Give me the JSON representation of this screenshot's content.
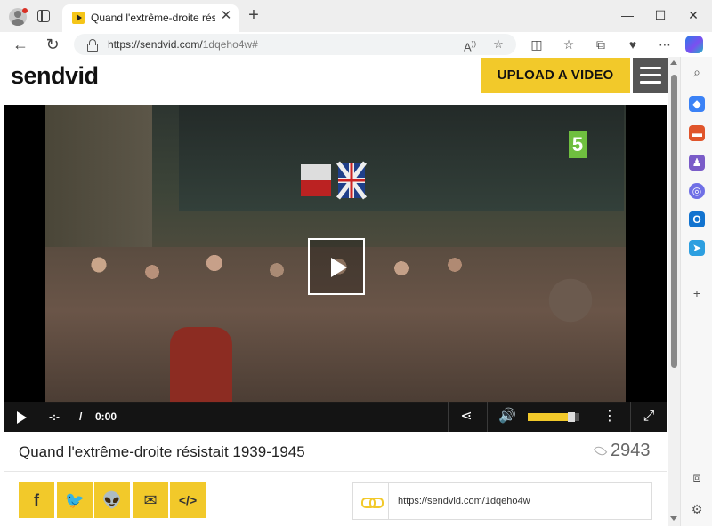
{
  "browser": {
    "tab_title": "Quand l'extrême-droite résistait",
    "url_host": "https://sendvid.com/",
    "url_path": "1dqeho4w#",
    "window_controls": {
      "minimize": "—",
      "maximize": "☐",
      "close": "✕"
    }
  },
  "page": {
    "logo": "sendvid",
    "upload_label": "UPLOAD A VIDEO"
  },
  "player": {
    "current_time": "-:-",
    "separator": "/",
    "duration": "0:00",
    "volume_fraction": 0.85,
    "channel_badge": "5"
  },
  "video": {
    "title": "Quand l'extrême-droite résistait 1939-1945",
    "views": "2943"
  },
  "share": {
    "buttons": [
      "f",
      "🐦",
      "👽",
      "✉",
      "</>"
    ],
    "link": "https://sendvid.com/1dqeho4w"
  },
  "colors": {
    "accent": "#f2c92a",
    "menu": "#555555",
    "controls": "#161616"
  }
}
